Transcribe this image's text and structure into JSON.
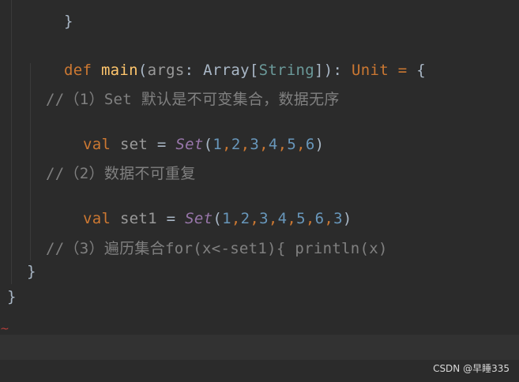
{
  "editor": {
    "line0": {
      "brace": "}"
    },
    "line_def": {
      "def": "def",
      "name": "main",
      "open": "(",
      "param": "args",
      "colon": ":",
      "type": "Array",
      "lbr": "[",
      "tparam": "String",
      "rbr": "]",
      "close": "):",
      "ret": "Unit",
      "eq": "=",
      "brace": "{"
    },
    "comment1": "//（1）Set 默认是不可变集合，数据无序",
    "line_val1": {
      "val": "val",
      "name": "set",
      "eq": "=",
      "fn": "Set",
      "open": "(",
      "nums": [
        "1",
        "2",
        "3",
        "4",
        "5",
        "6"
      ],
      "close": ")"
    },
    "comment2": "//（2）数据不可重复",
    "line_val2": {
      "val": "val",
      "name": "set1",
      "eq": "=",
      "fn": "Set",
      "open": "(",
      "nums": [
        "1",
        "2",
        "3",
        "4",
        "5",
        "6",
        "3"
      ],
      "close": ")"
    },
    "comment3": "//（3）遍历集合for(x<-set1){ println(x)",
    "close_inner": "}",
    "close_outer": "}",
    "squiggle": "~"
  },
  "watermark": "CSDN @早睡335",
  "colors": {
    "background": "#2b2b2b",
    "keyword": "#cc7832",
    "function": "#ffc66d",
    "number": "#6897bb",
    "comment": "#808080",
    "set_function": "#9876aa"
  }
}
